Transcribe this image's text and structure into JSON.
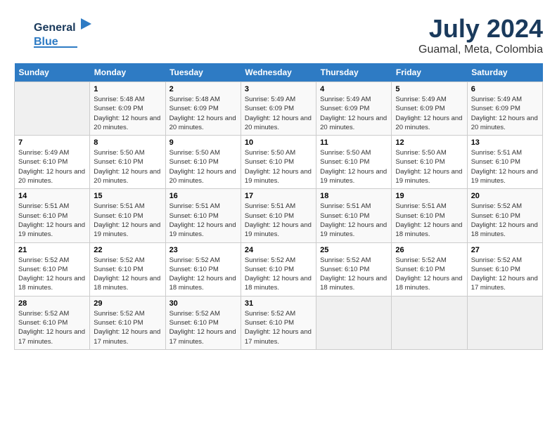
{
  "header": {
    "logo_line1": "General",
    "logo_line2": "Blue",
    "title": "July 2024",
    "subtitle": "Guamal, Meta, Colombia"
  },
  "days_of_week": [
    "Sunday",
    "Monday",
    "Tuesday",
    "Wednesday",
    "Thursday",
    "Friday",
    "Saturday"
  ],
  "weeks": [
    [
      {
        "day": "",
        "info": ""
      },
      {
        "day": "1",
        "info": "Sunrise: 5:48 AM\nSunset: 6:09 PM\nDaylight: 12 hours and 20 minutes."
      },
      {
        "day": "2",
        "info": "Sunrise: 5:48 AM\nSunset: 6:09 PM\nDaylight: 12 hours and 20 minutes."
      },
      {
        "day": "3",
        "info": "Sunrise: 5:49 AM\nSunset: 6:09 PM\nDaylight: 12 hours and 20 minutes."
      },
      {
        "day": "4",
        "info": "Sunrise: 5:49 AM\nSunset: 6:09 PM\nDaylight: 12 hours and 20 minutes."
      },
      {
        "day": "5",
        "info": "Sunrise: 5:49 AM\nSunset: 6:09 PM\nDaylight: 12 hours and 20 minutes."
      },
      {
        "day": "6",
        "info": "Sunrise: 5:49 AM\nSunset: 6:09 PM\nDaylight: 12 hours and 20 minutes."
      }
    ],
    [
      {
        "day": "7",
        "info": "Sunrise: 5:49 AM\nSunset: 6:10 PM\nDaylight: 12 hours and 20 minutes."
      },
      {
        "day": "8",
        "info": "Sunrise: 5:50 AM\nSunset: 6:10 PM\nDaylight: 12 hours and 20 minutes."
      },
      {
        "day": "9",
        "info": "Sunrise: 5:50 AM\nSunset: 6:10 PM\nDaylight: 12 hours and 20 minutes."
      },
      {
        "day": "10",
        "info": "Sunrise: 5:50 AM\nSunset: 6:10 PM\nDaylight: 12 hours and 19 minutes."
      },
      {
        "day": "11",
        "info": "Sunrise: 5:50 AM\nSunset: 6:10 PM\nDaylight: 12 hours and 19 minutes."
      },
      {
        "day": "12",
        "info": "Sunrise: 5:50 AM\nSunset: 6:10 PM\nDaylight: 12 hours and 19 minutes."
      },
      {
        "day": "13",
        "info": "Sunrise: 5:51 AM\nSunset: 6:10 PM\nDaylight: 12 hours and 19 minutes."
      }
    ],
    [
      {
        "day": "14",
        "info": "Sunrise: 5:51 AM\nSunset: 6:10 PM\nDaylight: 12 hours and 19 minutes."
      },
      {
        "day": "15",
        "info": "Sunrise: 5:51 AM\nSunset: 6:10 PM\nDaylight: 12 hours and 19 minutes."
      },
      {
        "day": "16",
        "info": "Sunrise: 5:51 AM\nSunset: 6:10 PM\nDaylight: 12 hours and 19 minutes."
      },
      {
        "day": "17",
        "info": "Sunrise: 5:51 AM\nSunset: 6:10 PM\nDaylight: 12 hours and 19 minutes."
      },
      {
        "day": "18",
        "info": "Sunrise: 5:51 AM\nSunset: 6:10 PM\nDaylight: 12 hours and 19 minutes."
      },
      {
        "day": "19",
        "info": "Sunrise: 5:51 AM\nSunset: 6:10 PM\nDaylight: 12 hours and 18 minutes."
      },
      {
        "day": "20",
        "info": "Sunrise: 5:52 AM\nSunset: 6:10 PM\nDaylight: 12 hours and 18 minutes."
      }
    ],
    [
      {
        "day": "21",
        "info": "Sunrise: 5:52 AM\nSunset: 6:10 PM\nDaylight: 12 hours and 18 minutes."
      },
      {
        "day": "22",
        "info": "Sunrise: 5:52 AM\nSunset: 6:10 PM\nDaylight: 12 hours and 18 minutes."
      },
      {
        "day": "23",
        "info": "Sunrise: 5:52 AM\nSunset: 6:10 PM\nDaylight: 12 hours and 18 minutes."
      },
      {
        "day": "24",
        "info": "Sunrise: 5:52 AM\nSunset: 6:10 PM\nDaylight: 12 hours and 18 minutes."
      },
      {
        "day": "25",
        "info": "Sunrise: 5:52 AM\nSunset: 6:10 PM\nDaylight: 12 hours and 18 minutes."
      },
      {
        "day": "26",
        "info": "Sunrise: 5:52 AM\nSunset: 6:10 PM\nDaylight: 12 hours and 18 minutes."
      },
      {
        "day": "27",
        "info": "Sunrise: 5:52 AM\nSunset: 6:10 PM\nDaylight: 12 hours and 17 minutes."
      }
    ],
    [
      {
        "day": "28",
        "info": "Sunrise: 5:52 AM\nSunset: 6:10 PM\nDaylight: 12 hours and 17 minutes."
      },
      {
        "day": "29",
        "info": "Sunrise: 5:52 AM\nSunset: 6:10 PM\nDaylight: 12 hours and 17 minutes."
      },
      {
        "day": "30",
        "info": "Sunrise: 5:52 AM\nSunset: 6:10 PM\nDaylight: 12 hours and 17 minutes."
      },
      {
        "day": "31",
        "info": "Sunrise: 5:52 AM\nSunset: 6:10 PM\nDaylight: 12 hours and 17 minutes."
      },
      {
        "day": "",
        "info": ""
      },
      {
        "day": "",
        "info": ""
      },
      {
        "day": "",
        "info": ""
      }
    ]
  ]
}
